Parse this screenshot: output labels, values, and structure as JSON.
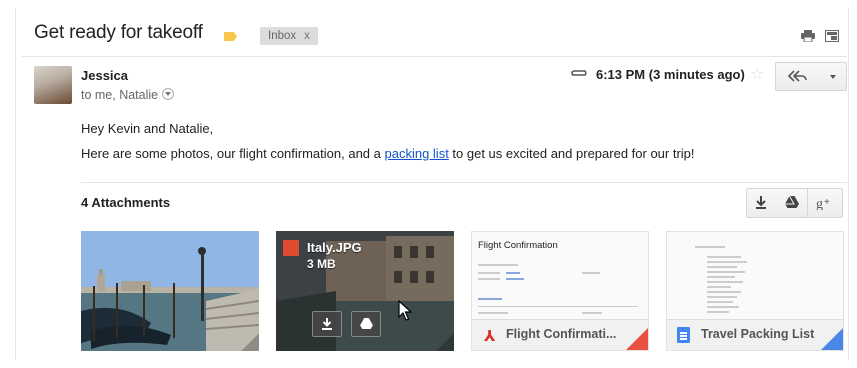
{
  "email": {
    "subject": "Get ready for takeoff",
    "label": "Inbox",
    "label_close": "x",
    "sender": "Jessica",
    "recipients": "to me, Natalie",
    "timestamp": "6:13 PM (3 minutes ago)",
    "greeting": "Hey Kevin and Natalie,",
    "body_before_link": "Here are some photos, our flight confirmation, and a ",
    "link_text": "packing list",
    "body_after_link": " to get us excited and prepared for our trip!"
  },
  "attachments": {
    "title": "4 Attachments",
    "items": [
      {
        "type": "image"
      },
      {
        "type": "image",
        "name": "Italy.JPG",
        "size": "3 MB"
      },
      {
        "type": "pdf",
        "name": "Flight Confirmati...",
        "preview_title": "Flight Confirmation"
      },
      {
        "type": "doc",
        "name": "Travel Packing List"
      }
    ]
  },
  "icons": {
    "print": "print-icon",
    "new_window": "new-window-icon",
    "attachment": "paperclip-icon",
    "star": "star-icon",
    "reply": "reply-all-icon",
    "more": "chevron-down-icon",
    "download_all": "download-icon",
    "drive": "drive-icon",
    "gplus": "google-plus-icon"
  },
  "colors": {
    "link": "#1155cc",
    "important_tag": "#f6c74a",
    "pdf_accent": "#e8523f",
    "doc_accent": "#4a86e8"
  }
}
